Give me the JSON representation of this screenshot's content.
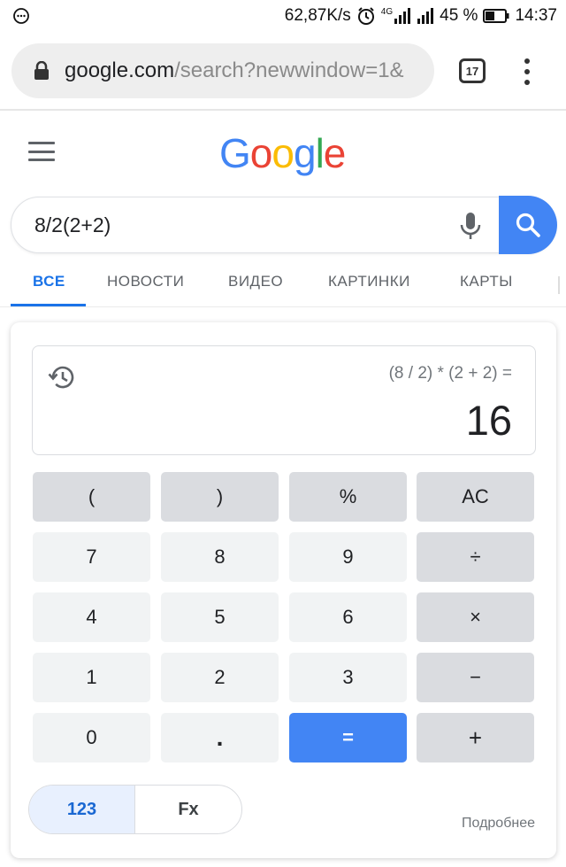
{
  "status_bar": {
    "speed": "62,87K/s",
    "network_label": "4G",
    "battery": "45 %",
    "time": "14:37",
    "icons": [
      "chat-bubble-icon",
      "alarm-icon",
      "signal-icon",
      "battery-icon"
    ]
  },
  "browser": {
    "url_domain": "google.com",
    "url_path": "/search?newwindow=1&",
    "tab_count": "17"
  },
  "google": {
    "logo_letters": [
      "G",
      "o",
      "o",
      "g",
      "l",
      "e"
    ],
    "logo_colors": [
      "#4285F4",
      "#EA4335",
      "#FBBC05",
      "#4285F4",
      "#34A853",
      "#EA4335"
    ],
    "search_query": "8/2(2+2)",
    "tabs": [
      {
        "label": "ВСЕ",
        "active": true
      },
      {
        "label": "НОВОСТИ",
        "active": false
      },
      {
        "label": "ВИДЕО",
        "active": false
      },
      {
        "label": "КАРТИНКИ",
        "active": false
      },
      {
        "label": "КАРТЫ",
        "active": false
      }
    ]
  },
  "calculator": {
    "expression": "(8 / 2) * (2 + 2) =",
    "result": "16",
    "keys": [
      [
        {
          "label": "(",
          "type": "op"
        },
        {
          "label": ")",
          "type": "op"
        },
        {
          "label": "%",
          "type": "op"
        },
        {
          "label": "AC",
          "type": "op"
        }
      ],
      [
        {
          "label": "7",
          "type": "num"
        },
        {
          "label": "8",
          "type": "num"
        },
        {
          "label": "9",
          "type": "num"
        },
        {
          "label": "÷",
          "type": "op"
        }
      ],
      [
        {
          "label": "4",
          "type": "num"
        },
        {
          "label": "5",
          "type": "num"
        },
        {
          "label": "6",
          "type": "num"
        },
        {
          "label": "×",
          "type": "op"
        }
      ],
      [
        {
          "label": "1",
          "type": "num"
        },
        {
          "label": "2",
          "type": "num"
        },
        {
          "label": "3",
          "type": "num"
        },
        {
          "label": "−",
          "type": "op"
        }
      ],
      [
        {
          "label": "0",
          "type": "num"
        },
        {
          "label": ".",
          "type": "num"
        },
        {
          "label": "=",
          "type": "eq"
        },
        {
          "label": "+",
          "type": "op"
        }
      ]
    ],
    "mode_basic": "123",
    "mode_functions": "Fx",
    "more_link": "Подробнее"
  },
  "colors": {
    "accent_blue": "#4285f4",
    "link_blue": "#1a73e8"
  }
}
